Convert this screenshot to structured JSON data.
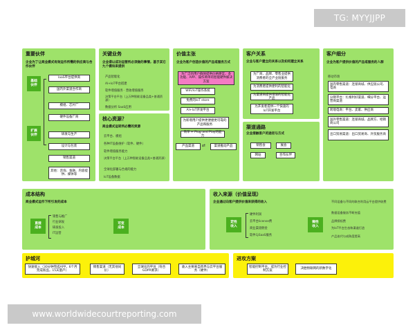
{
  "watermark_top": "TG: MYYJJPP",
  "watermark_bottom": "www.worldwidecourtreporting.com",
  "partners": {
    "title": "重要伙伴",
    "subtitle": "企业为了让商业模式有效运作所需的供应商与合作伙伴",
    "tag_basic": "基础\n伙伴",
    "tag_expand": "扩展\n伙伴",
    "basic_items": [
      "IaaS平台提供商",
      "国内外渠道合作商",
      "模组、芯片厂",
      "硬件设备厂商"
    ],
    "expand_items": [
      "研发与生产",
      "设计与包装",
      "销售渠道",
      "其他：咨询、金融、内容提供、媒体等"
    ]
  },
  "activities": {
    "title": "关键业务",
    "subtitle": "企业得以成功运营所必须做的事情，基于其它九个模块来提供",
    "items": [
      "产品智能化",
      "AI+IoT平台搭建",
      "软件增值服务 · 营收增值服务",
      "决策平台平台（上万种智能设备品类+普通资源）",
      "数据分析 SaaS应用"
    ]
  },
  "resources": {
    "title": "核心资源？",
    "subtitle": "商业模式运转所必需的资源",
    "items": [
      "云平台、模组",
      "各种IT设备维护（软件、硬件）",
      "软件增值服务能力",
      "决策平台平台（上万种智能设备品类+普通资源）",
      "全球化部署与合规的能力",
      "IoT设备数据"
    ]
  },
  "value": {
    "title": "价值主张",
    "subtitle": "企业为客户创造价值的产品或服务方式",
    "highlight": "为广泛的用户群体提供价格便宜、多功能、APP、操作简单的智能硬件解决方案",
    "items": [
      "WiFi/IoT操作系统",
      "免费的IoT store",
      "AI+IoT开发平台",
      "为新增用户提供更便捷更可靠的产品和服务",
      "简单 + Plug and Play的能力"
    ],
    "flow_left": "产品渠道",
    "flow_right": "渠道推动产品"
  },
  "relations": {
    "title": "客户关系",
    "subtitle": "企业与客户建立的关系以及如何建立关系",
    "items": [
      "为厂商、品牌、零售业提供消费者的全产业链服务",
      "为消费者提供便利的智能化",
      "为渠道商提供增值的智能化产品",
      "为开发者提供一个快速的IoT开发平台"
    ]
  },
  "channels": {
    "title": "渠道通路",
    "subtitle": "企业接触客户的途径与方式",
    "items": [
      "销售会",
      "展会",
      "网站",
      "合作伙伴"
    ]
  },
  "segments": {
    "title": "客户细分",
    "subtitle": "企业为客户提供价值的产品或服务的人群",
    "label_main": "移动市场",
    "items": [
      "国内零售渠道：连锁商城、供应链公司、电商",
      "分销平台：扎根利好渠道、细分平台、运营商渠道",
      "跨境电商：平台、卖家、供应商",
      "国外零售渠道：连锁商城、品牌方、经销商公司",
      "出口贸易渠道：出口贸易商、外贸服务商"
    ]
  },
  "costs": {
    "title": "成本结构",
    "subtitle": "商业模式运作下所引发的成本",
    "tag_direct": "直接\n成本",
    "direct_items": [
      "销售与推广",
      "行业研发",
      "研发投入",
      "IT运营"
    ],
    "tag_variable": "可变\n成本"
  },
  "revenue": {
    "title": "收入来源（价值呈现）",
    "subtitle": "企业通过向客户提供价值来获得的收入",
    "tag_main": "定性\n收入",
    "main_items": [
      "硬件利润",
      "云平台license费",
      "商业渠道佣金",
      "软件与SaaS服务"
    ],
    "tag_small": "微性\n收入",
    "side_items": [
      "不同设备与不同的联合利用云平台提供收费",
      "数据设备服务不断充值",
      "品牌授权费",
      "为IoT平台生态和渠道打造",
      "产品迭代与成熟度提高"
    ]
  },
  "moat": {
    "title": "护城河",
    "items": [
      "快速接入（30分钟完成APP，6个月完成新品，15天量产）",
      "销售渠道（无其他同价）",
      "全球化的平台（符合GDPR要求）",
      "收入主要来自跨界与云平台服务（硬件）"
    ]
  },
  "progress": {
    "title": "进攻方案",
    "items": [
      "智能控制平台，成为行业控制方案",
      "决胜物联网的新数字化"
    ]
  }
}
